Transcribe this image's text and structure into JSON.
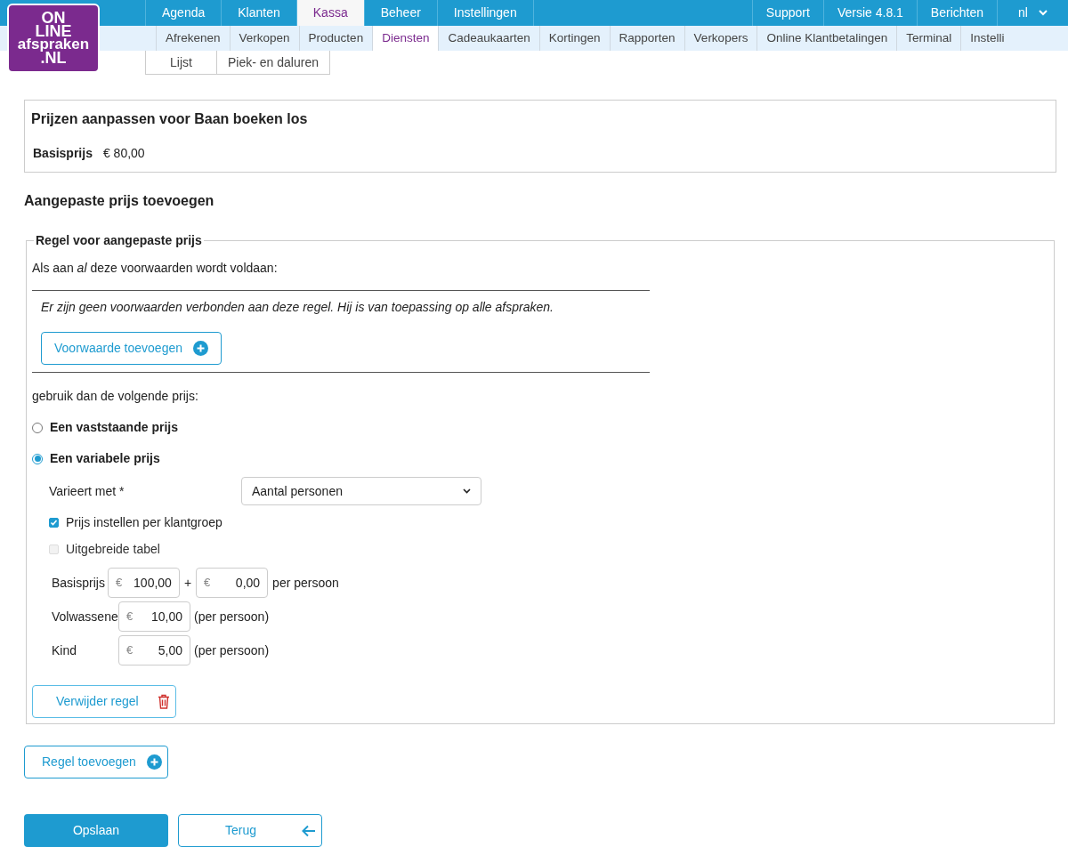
{
  "logo": {
    "lines": [
      "ON",
      "LINE",
      "afspraken",
      ".NL"
    ]
  },
  "top_nav": {
    "tabs": [
      {
        "label": "Agenda",
        "selected": false
      },
      {
        "label": "Klanten",
        "selected": false
      },
      {
        "label": "Kassa",
        "selected": true
      },
      {
        "label": "Beheer",
        "selected": false
      },
      {
        "label": "Instellingen",
        "selected": false
      }
    ],
    "right_items": [
      "Support",
      "Versie 4.8.1",
      "Berichten"
    ],
    "language": "nl"
  },
  "sub_nav": [
    {
      "label": "Afrekenen",
      "selected": false
    },
    {
      "label": "Verkopen",
      "selected": false
    },
    {
      "label": "Producten",
      "selected": false
    },
    {
      "label": "Diensten",
      "selected": true
    },
    {
      "label": "Cadeaukaarten",
      "selected": false
    },
    {
      "label": "Kortingen",
      "selected": false
    },
    {
      "label": "Rapporten",
      "selected": false
    },
    {
      "label": "Verkopers",
      "selected": false
    },
    {
      "label": "Online Klantbetalingen",
      "selected": false
    },
    {
      "label": "Terminal",
      "selected": false
    },
    {
      "label": "Instelli",
      "selected": false
    }
  ],
  "sub_sub_nav": [
    "Lijst",
    "Piek- en daluren"
  ],
  "price_card": {
    "title": "Prijzen aanpassen voor Baan boeken los",
    "base_label": "Basisprijs",
    "base_value": "€ 80,00"
  },
  "section_title": "Aangepaste prijs toevoegen",
  "rule": {
    "legend": "Regel voor aangepaste prijs",
    "condition_intro": "Als aan *al* deze voorwaarden wordt voldaan:",
    "no_conditions": "Er zijn geen voorwaarden verbonden aan deze regel. Hij is van toepassing op alle afspraken.",
    "add_condition_button": "Voorwaarde toevoegen",
    "then_text": "gebruik dan de volgende prijs:",
    "options": [
      {
        "label": "Een vaststaande prijs",
        "selected": false
      },
      {
        "label": "Een variabele prijs",
        "selected": true
      }
    ],
    "varies_label": "Varieert met *",
    "varies_value": "Aantal personen",
    "checkboxes": [
      {
        "label": "Prijs instellen per klantgroep",
        "checked": true,
        "disabled": false
      },
      {
        "label": "Uitgebreide tabel",
        "checked": false,
        "disabled": true
      }
    ],
    "base_row": {
      "label": "Basisprijs",
      "currency": "€",
      "value": "100,00",
      "plus": "+",
      "currency_2": "€",
      "value_2": "0,00",
      "suffix": "per persoon"
    },
    "group_rows": [
      {
        "label": "Volwassene",
        "currency": "€",
        "value": "10,00",
        "suffix": "(per persoon)"
      },
      {
        "label": "Kind",
        "currency": "€",
        "value": "5,00",
        "suffix": "(per persoon)"
      }
    ],
    "delete_button": "Verwijder regel"
  },
  "add_rule_button": "Regel toevoegen",
  "save_button": "Opslaan",
  "back_button": "Terug"
}
